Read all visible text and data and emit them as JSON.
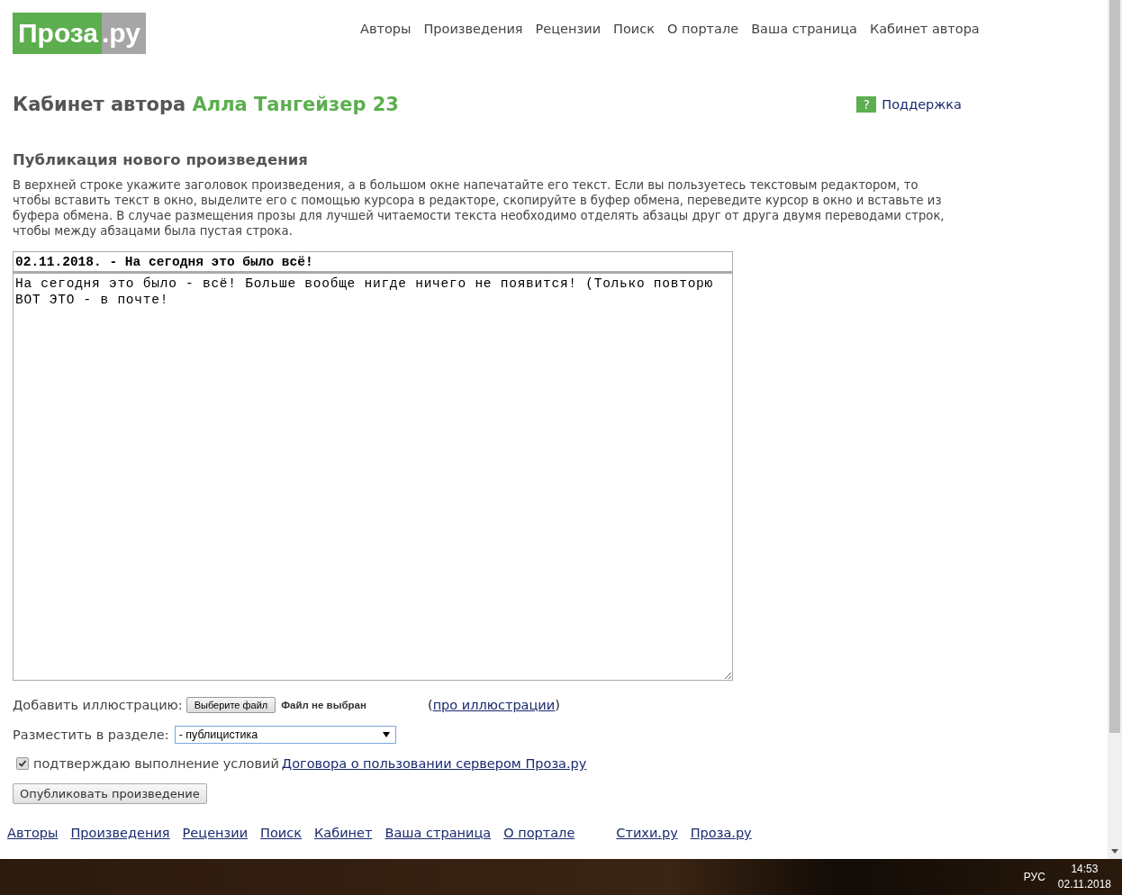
{
  "header": {
    "logo": {
      "main": "Проза",
      "suffix": ".ру"
    },
    "nav": [
      "Авторы",
      "Произведения",
      "Рецензии",
      "Поиск",
      "О портале",
      "Ваша страница",
      "Кабинет автора"
    ]
  },
  "cabinet": {
    "label": "Кабинет автора",
    "author": "Алла Тангейзер 23",
    "support_icon": "?",
    "support": "Поддержка"
  },
  "form": {
    "heading": "Публикация нового произведения",
    "intro": "В верхней строке укажите заголовок произведения, а в большом окне напечатайте его текст. Если вы пользуетесь текстовым редактором, то чтобы вставить текст в окно, выделите его с помощью курсора в редакторе, скопируйте в буфер обмена, переведите курсор в окно и вставьте из буфера обмена. В случае размещения прозы для лучшей читаемости текста необходимо отделять абзацы друг от друга двумя переводами строк, чтобы между абзацами была пустая строка.",
    "title_value": "02.11.2018. - На сегодня это было всё!",
    "body_value": "На сегодня это было - всё! Больше вообще нигде ничего не появится! (Только повторю ВОТ ЭТО - в почте!",
    "illustration": {
      "label": "Добавить иллюстрацию:",
      "button": "Выберите файл",
      "status": "Файл не выбран",
      "link_open": "(",
      "link": "про иллюстрации",
      "link_close": ")"
    },
    "section": {
      "label": "Разместить в разделе:",
      "value": "- публицистика"
    },
    "agree": {
      "checked": true,
      "text": "подтверждаю выполнение условий",
      "link": "Договора о пользовании сервером Проза.ру"
    },
    "submit": "Опубликовать произведение"
  },
  "footer_links": [
    "Авторы",
    "Произведения",
    "Рецензии",
    "Поиск",
    "Кабинет",
    "Ваша страница",
    "О портале"
  ],
  "footer_sites": [
    "Стихи.ру",
    "Проза.ру"
  ],
  "taskbar": {
    "language": "РУС",
    "time": "14:53",
    "date": "02.11.2018"
  }
}
